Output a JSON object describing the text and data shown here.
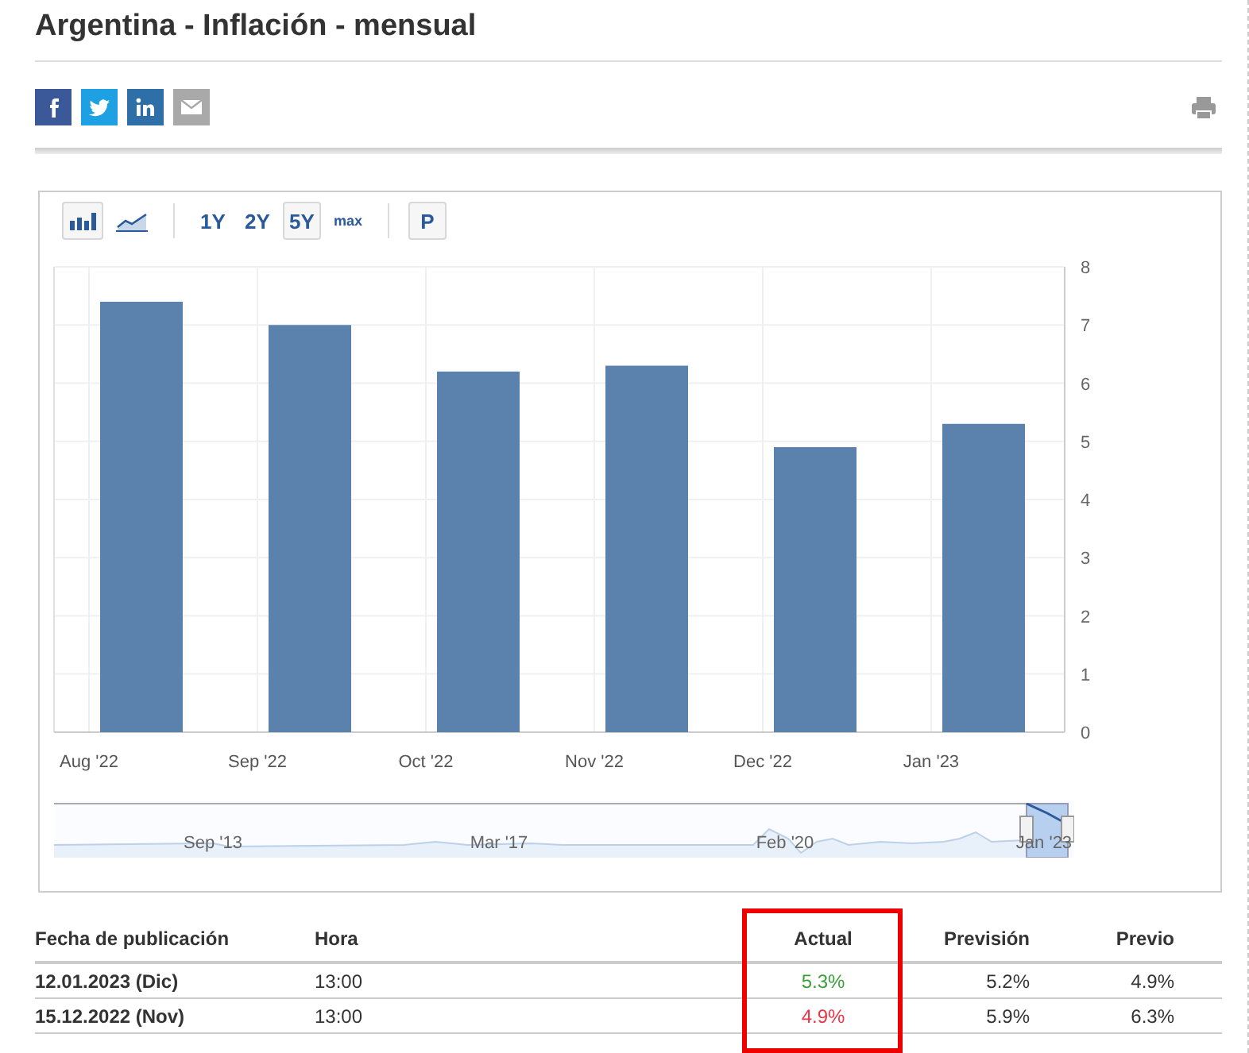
{
  "title": "Argentina - Inflación - mensual",
  "share": [
    {
      "kind": "facebook"
    },
    {
      "kind": "twitter"
    },
    {
      "kind": "linkedin"
    },
    {
      "kind": "email"
    }
  ],
  "toolbar": [
    {
      "kind": "bar-chart",
      "selected": true
    },
    {
      "kind": "area-chart",
      "selected": false
    },
    {
      "kind": "sep"
    },
    {
      "kind": "text",
      "label": "1Y",
      "selected": false
    },
    {
      "kind": "text",
      "label": "2Y",
      "selected": false
    },
    {
      "kind": "text",
      "label": "5Y",
      "selected": true
    },
    {
      "kind": "small",
      "label": "max",
      "selected": false
    },
    {
      "kind": "sep"
    },
    {
      "kind": "text",
      "label": "P",
      "selected": true
    }
  ],
  "chart_data": {
    "type": "bar",
    "categories": [
      "Aug '22",
      "Sep '22",
      "Oct '22",
      "Nov '22",
      "Dec '22",
      "Jan '23"
    ],
    "series": [
      {
        "color": "#5b81ad",
        "values": [
          7.4,
          7.0,
          6.2,
          6.3,
          4.9,
          5.3
        ]
      }
    ],
    "grid": true,
    "ylim": [
      0,
      8
    ],
    "yticks": [
      0,
      1,
      2,
      3,
      4,
      5,
      6,
      7,
      8
    ]
  },
  "navigator": {
    "labels": [
      "Sep '13",
      "Mar '17",
      "Feb '20",
      "Jan '23"
    ]
  },
  "table": {
    "columns": [
      {
        "label": "Fecha de publicación",
        "highlighted": false
      },
      {
        "label": "Hora",
        "highlighted": false
      },
      {
        "label": "Actual",
        "highlighted": true
      },
      {
        "label": "Previsión",
        "highlighted": false
      },
      {
        "label": "Previo",
        "highlighted": false
      }
    ],
    "rows": [
      {
        "date": "12.01.2023 (Dic)",
        "time": "13:00",
        "actual": "5.3%",
        "color": "#3aa03a",
        "forecast": "5.2%",
        "previous": "4.9%"
      },
      {
        "date": "15.12.2022 (Nov)",
        "time": "13:00",
        "actual": "4.9%",
        "color": "#ee3344",
        "forecast": "5.9%",
        "previous": "6.3%"
      }
    ]
  }
}
